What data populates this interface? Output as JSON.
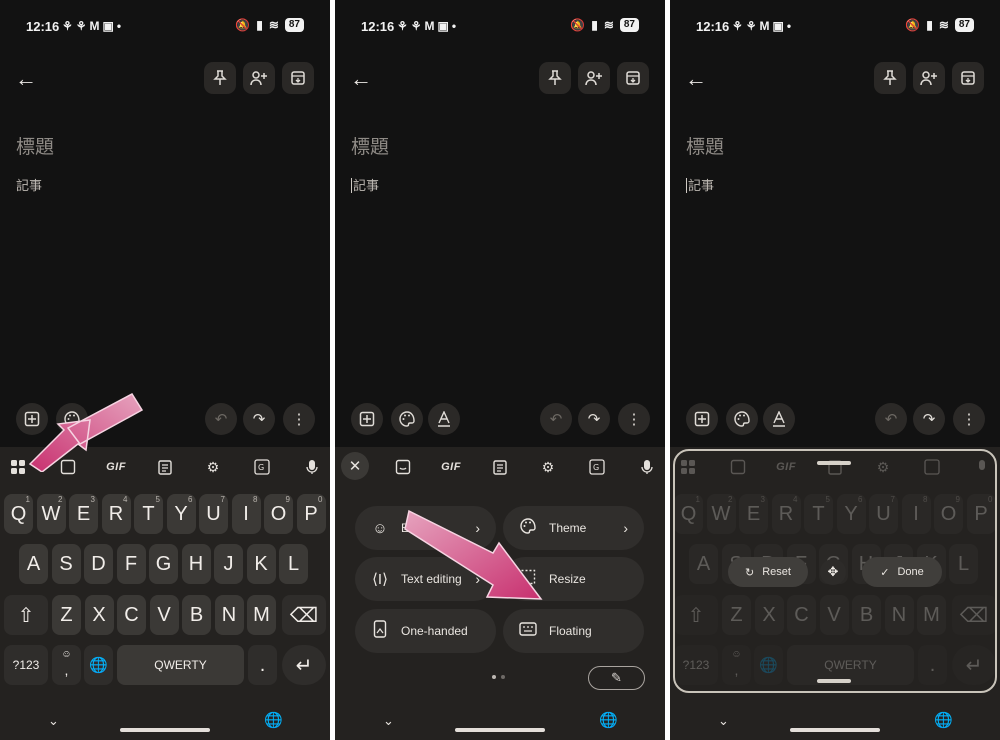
{
  "statusbar": {
    "time": "12:16",
    "notifications": "⚘⚘M▣•",
    "battery": "87"
  },
  "note": {
    "title_placeholder": "標題",
    "body_placeholder": "記事"
  },
  "keyboard": {
    "strip_gif": "GIF",
    "row1": [
      "Q",
      "W",
      "E",
      "R",
      "T",
      "Y",
      "U",
      "I",
      "O",
      "P"
    ],
    "row1_hints": [
      "1",
      "2",
      "3",
      "4",
      "5",
      "6",
      "7",
      "8",
      "9",
      "0"
    ],
    "row2": [
      "A",
      "S",
      "D",
      "F",
      "G",
      "H",
      "J",
      "K",
      "L"
    ],
    "row3": [
      "Z",
      "X",
      "C",
      "V",
      "B",
      "N",
      "M"
    ],
    "sym_key": "?123",
    "comma_key": ",",
    "space_label": "QWERTY",
    "period_key": "."
  },
  "menu": {
    "items": [
      {
        "label": "E",
        "icon": "emoji-icon"
      },
      {
        "label": "Theme",
        "icon": "palette-icon"
      },
      {
        "label": "Text editing",
        "icon": "text-cursor-icon"
      },
      {
        "label": "Resize",
        "icon": "resize-icon"
      },
      {
        "label": "One-handed",
        "icon": "one-handed-icon"
      },
      {
        "label": "Floating",
        "icon": "floating-keyboard-icon"
      }
    ]
  },
  "resize": {
    "reset_label": "Reset",
    "done_label": "Done"
  },
  "colors": {
    "background": "#121212",
    "keyboard": "#242220",
    "key": "#3b3936",
    "arrow": "#d6417e"
  }
}
